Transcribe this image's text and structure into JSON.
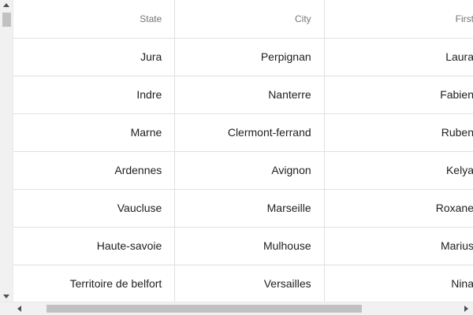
{
  "columns": {
    "state": "State",
    "city": "City",
    "first": "First"
  },
  "rows": [
    {
      "state": "Jura",
      "city": "Perpignan",
      "first": "Laura"
    },
    {
      "state": "Indre",
      "city": "Nanterre",
      "first": "Fabien"
    },
    {
      "state": "Marne",
      "city": "Clermont-ferrand",
      "first": "Ruben"
    },
    {
      "state": "Ardennes",
      "city": "Avignon",
      "first": "Kelya"
    },
    {
      "state": "Vaucluse",
      "city": "Marseille",
      "first": "Roxane"
    },
    {
      "state": "Haute-savoie",
      "city": "Mulhouse",
      "first": "Marius"
    },
    {
      "state": "Territoire de belfort",
      "city": "Versailles",
      "first": "Nina"
    }
  ],
  "colors": {
    "header_text": "#757575",
    "cell_text": "#212121",
    "border": "#e0e0e0",
    "scrollbar_track": "#f1f1f1",
    "scrollbar_thumb": "#c1c1c1"
  },
  "icons": {
    "scroll_up": "triangle-up-icon",
    "scroll_down": "triangle-down-icon",
    "scroll_left": "triangle-left-icon",
    "scroll_right": "triangle-right-icon"
  }
}
